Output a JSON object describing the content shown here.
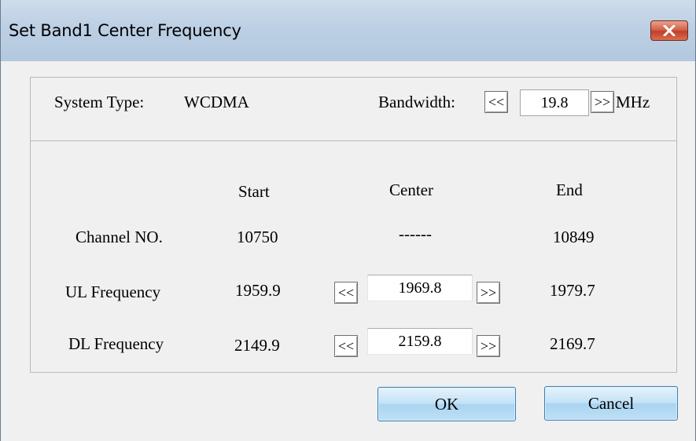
{
  "window": {
    "title": "Set Band1 Center Frequency"
  },
  "system": {
    "label": "System Type:",
    "value": "WCDMA"
  },
  "bandwidth": {
    "label": "Bandwidth:",
    "dec": "<<",
    "value": "19.8",
    "inc": ">>",
    "unit": "MHz"
  },
  "table": {
    "headers": [
      "Start",
      "Center",
      "End"
    ],
    "rows": [
      {
        "label": "Channel NO.",
        "start": "10750",
        "center": "------",
        "end": "10849"
      },
      {
        "label": "UL Frequency",
        "start": "1959.9",
        "center": "1969.8",
        "end": "1979.7",
        "dec": "<<",
        "inc": ">>"
      },
      {
        "label": "DL Frequency",
        "start": "2149.9",
        "center": "2159.8",
        "end": "2169.7",
        "dec": "<<",
        "inc": ">>"
      }
    ]
  },
  "buttons": {
    "ok": "OK",
    "cancel": "Cancel"
  },
  "colors": {
    "titlebar": "#bccfe4",
    "close": "#c0402a",
    "button": "#bfe0f6"
  }
}
